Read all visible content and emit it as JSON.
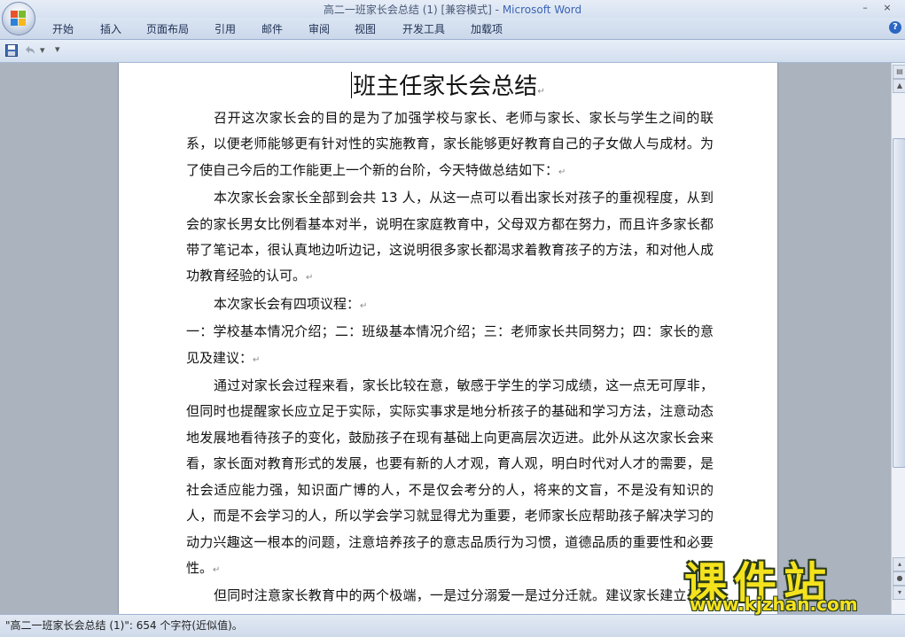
{
  "window": {
    "title_doc": "高二一班家长会总结 (1) [兼容模式] - ",
    "title_app": "Microsoft Word",
    "minimize": "–",
    "close": "×"
  },
  "ribbon": {
    "tabs": [
      "开始",
      "插入",
      "页面布局",
      "引用",
      "邮件",
      "审阅",
      "视图",
      "开发工具",
      "加载项"
    ]
  },
  "qat": {
    "save_icon": "save-icon",
    "undo_icon": "undo-icon",
    "more": "▾"
  },
  "document": {
    "title": "班主任家长会总结",
    "paragraphs": [
      "召开这次家长会的目的是为了加强学校与家长、老师与家长、家长与学生之间的联系，以便老师能够更有针对性的实施教育，家长能够更好教育自己的子女做人与成材。为了使自己今后的工作能更上一个新的台阶，今天特做总结如下：",
      " 本次家长会家长全部到会共 13 人，从这一点可以看出家长对孩子的重视程度，从到会的家长男女比例看基本对半，说明在家庭教育中，父母双方都在努力，而且许多家长都带了笔记本，很认真地边听边记，这说明很多家长都渴求着教育孩子的方法，和对他人成功教育经验的认可。",
      "本次家长会有四项议程：",
      "一：学校基本情况介绍；二：班级基本情况介绍；三：老师家长共同努力；四：家长的意见及建议：",
      "通过对家长会过程来看，家长比较在意，敏感于学生的学习成绩，这一点无可厚非，但同时也提醒家长应立足于实际，实际实事求是地分析孩子的基础和学习方法，注意动态地发展地看待孩子的变化，鼓励孩子在现有基础上向更高层次迈进。此外从这次家长会来看，家长面对教育形式的发展，也要有新的人才观，育人观，明白时代对人才的需要，是社会适应能力强，知识面广博的人，不是仅会考分的人，将来的文盲，不是没有知识的人，而是不会学习的人，所以学会学习就显得尤为重要，老师家长应帮助孩子解决学习的动力兴趣这一根本的问题，注意培养孩子的意志品质行为习惯，道德品质的重要性和必要性。",
      "但同时注意家长教育中的两个极端，一是过分溺爱一是过分迁就。建议家长建立平等的和谐的民主家庭，通过分析交流许多家长明白了家庭教育的重要性。最后以"
    ],
    "para_mark": "↵"
  },
  "status": {
    "text": "\"高二一班家长会总结 (1)\": 654 个字符(近似值)。"
  },
  "watermark": {
    "title": "课件站",
    "url": "www.kjzhan.com"
  }
}
